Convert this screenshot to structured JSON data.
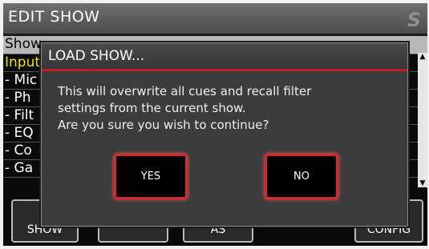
{
  "window": {
    "title": "EDIT SHOW"
  },
  "list": {
    "header": "Show",
    "rows": [
      {
        "label": "Input",
        "style": "yellow"
      },
      {
        "label": " - Mic",
        "style": "white"
      },
      {
        "label": " - Ph",
        "style": "white"
      },
      {
        "label": " - Filt",
        "style": "white"
      },
      {
        "label": " - EQ",
        "style": "white"
      },
      {
        "label": " - Co",
        "style": "white"
      },
      {
        "label": " - Ga",
        "style": "white"
      }
    ]
  },
  "bottom_buttons": [
    {
      "label": "SHOW"
    },
    {
      "label": ""
    },
    {
      "label": "AS"
    },
    {
      "label": "CONFIG"
    }
  ],
  "dialog": {
    "title": "LOAD SHOW...",
    "message": "This will overwrite all cues and recall filter\nsettings from the current show.\nAre you sure you wish to continue?",
    "yes_label": "YES",
    "no_label": "NO"
  },
  "colors": {
    "accent_red": "#d42a2a",
    "list_highlight_yellow": "#f3e000",
    "dialog_bg": "#3c3c3c"
  }
}
